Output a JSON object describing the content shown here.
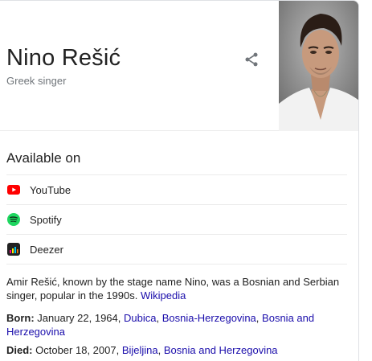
{
  "header": {
    "title": "Nino Rešić",
    "subtitle": "Greek singer",
    "share_icon": "share-icon",
    "photo": "portrait-photo"
  },
  "available_on": {
    "heading": "Available on",
    "providers": [
      {
        "label": "YouTube",
        "icon": "youtube-icon",
        "color": "#ff0000"
      },
      {
        "label": "Spotify",
        "icon": "spotify-icon",
        "color": "#1ed760"
      },
      {
        "label": "Deezer",
        "icon": "deezer-icon",
        "color": "#222222"
      }
    ]
  },
  "description": {
    "text": "Amir Rešić, known by the stage name Nino, was a Bosnian and Serbian singer, popular in the 1990s.",
    "source_link": "Wikipedia"
  },
  "facts": {
    "born": {
      "label": "Born:",
      "date": "January 22, 1964,",
      "place_link": "Dubica",
      "sep1": ",",
      "region_link": "Bosnia-Herzegovina",
      "sep2": ",",
      "country_link": "Bosnia and Herzegovina"
    },
    "died": {
      "label": "Died:",
      "date": "October 18, 2007,",
      "place_link": "Bijeljina",
      "sep1": ",",
      "country_link": "Bosnia and Herzegovina"
    }
  },
  "colors": {
    "link": "#1a0dab",
    "secondary_text": "#70757a",
    "divider": "#ebebeb"
  }
}
